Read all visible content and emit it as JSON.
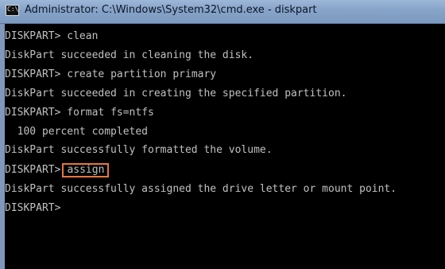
{
  "window": {
    "title": "Administrator: C:\\Windows\\System32\\cmd.exe - diskpart",
    "icon": "cmd-icon",
    "icon_glyph": "C:\\"
  },
  "console": {
    "lines": [
      {
        "prompt": "DISKPART> ",
        "command": "clean"
      },
      {
        "text": "DiskPart succeeded in cleaning the disk."
      },
      {
        "prompt": "DISKPART> ",
        "command": "create partition primary"
      },
      {
        "text": "DiskPart succeeded in creating the specified partition."
      },
      {
        "prompt": "DISKPART> ",
        "command": "format fs=ntfs"
      },
      {
        "text": "  100 percent completed"
      },
      {
        "text": "DiskPart successfully formatted the volume."
      },
      {
        "prompt": "DISKPART>",
        "command": "assign",
        "highlighted": true,
        "highlight_color": "#e8763d"
      },
      {
        "text": "DiskPart successfully assigned the drive letter or mount point."
      },
      {
        "prompt": "DISKPART>"
      }
    ]
  }
}
